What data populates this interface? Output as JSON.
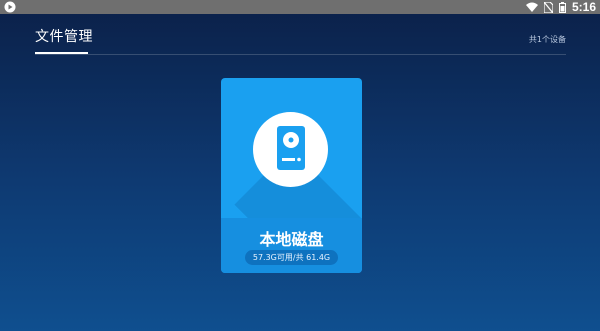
{
  "status_bar": {
    "time": "5:16",
    "icons": [
      "app-play-icon",
      "wifi-icon",
      "no-sim-icon",
      "battery-icon"
    ]
  },
  "header": {
    "title": "文件管理",
    "device_count": "共1个设备"
  },
  "devices": [
    {
      "name": "本地磁盘",
      "usage": "57.3G可用/共 61.4G",
      "icon": "hard-disk-icon"
    }
  ],
  "colors": {
    "background_top": "#0b2048",
    "background_bottom": "#0f4f8f",
    "card": "#1aa0f0",
    "card_footer": "#168fe0"
  }
}
